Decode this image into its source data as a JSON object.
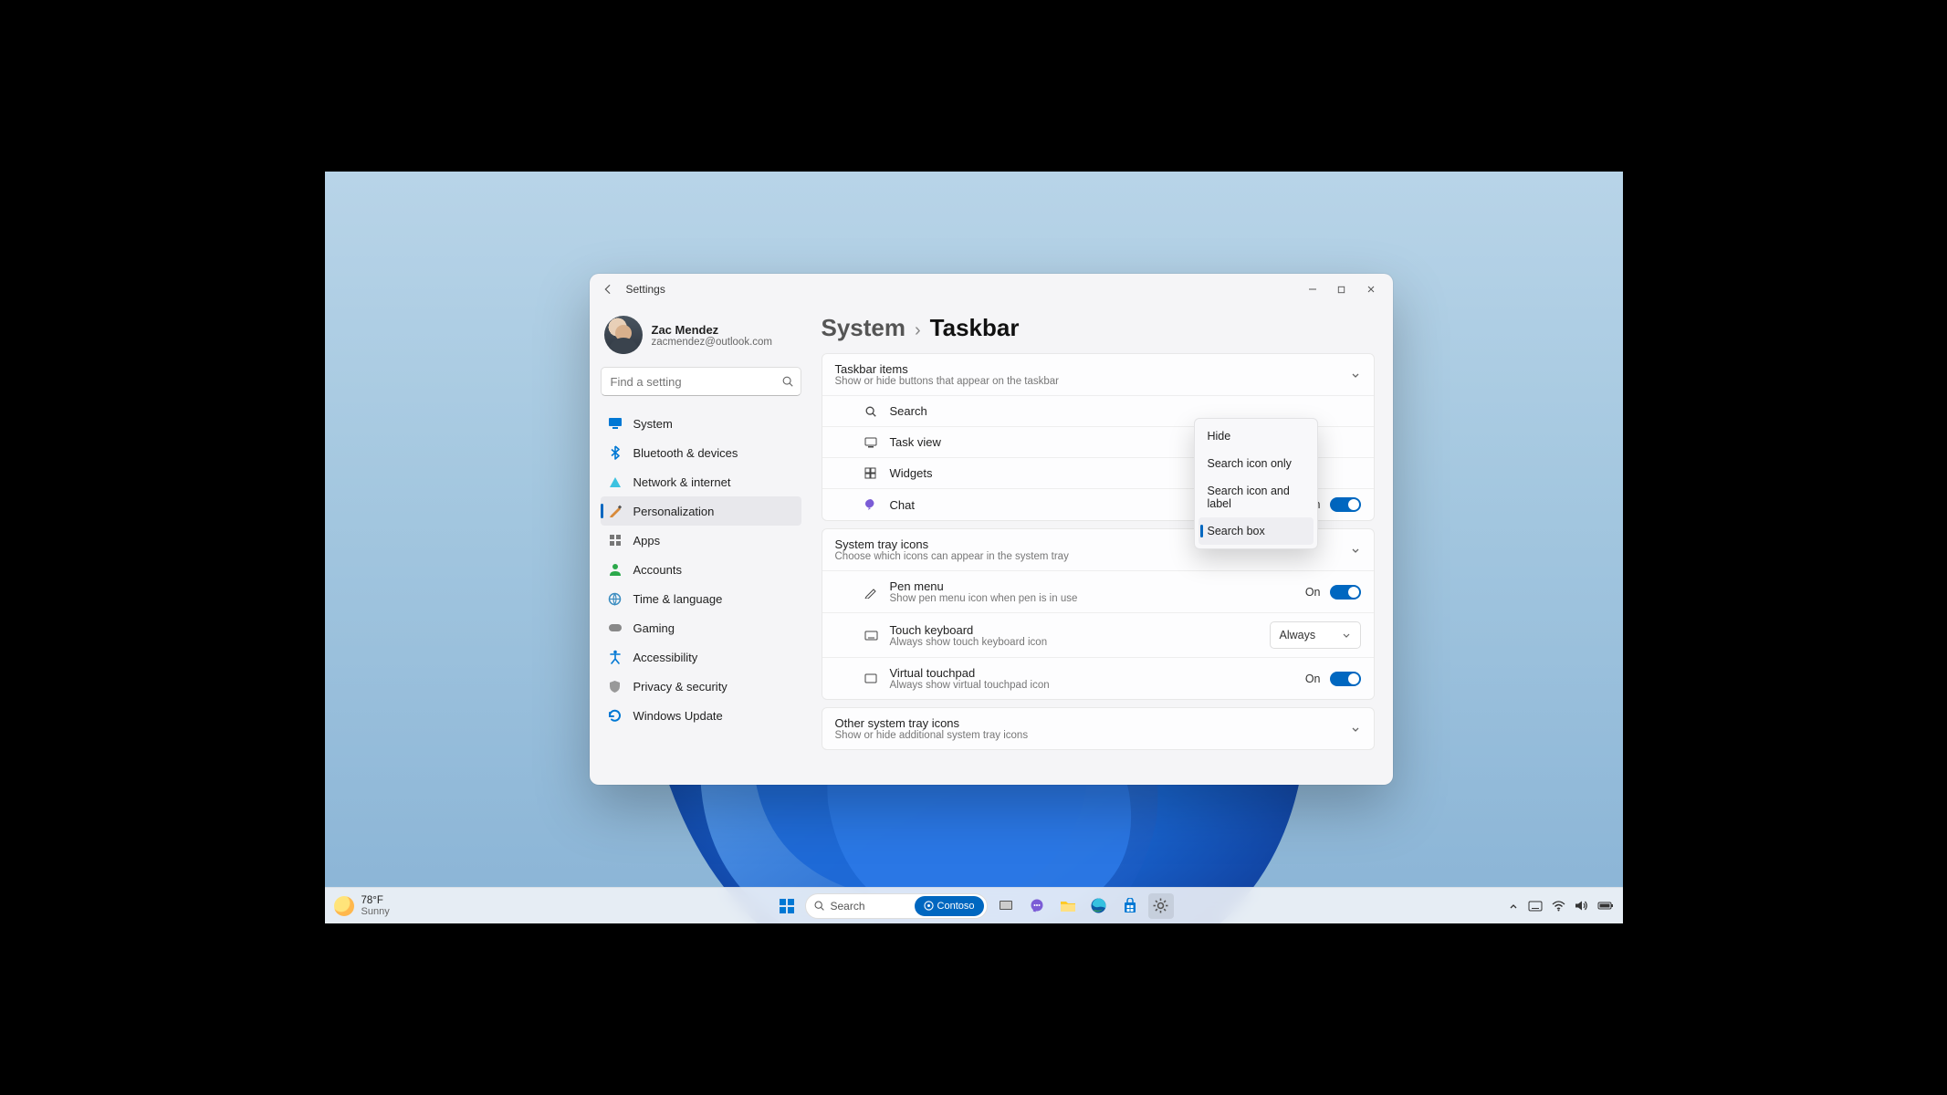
{
  "window": {
    "title": "Settings"
  },
  "profile": {
    "name": "Zac Mendez",
    "email": "zacmendez@outlook.com"
  },
  "search": {
    "placeholder": "Find a setting"
  },
  "sidebar": {
    "items": [
      {
        "label": "System"
      },
      {
        "label": "Bluetooth & devices"
      },
      {
        "label": "Network & internet"
      },
      {
        "label": "Personalization"
      },
      {
        "label": "Apps"
      },
      {
        "label": "Accounts"
      },
      {
        "label": "Time & language"
      },
      {
        "label": "Gaming"
      },
      {
        "label": "Accessibility"
      },
      {
        "label": "Privacy & security"
      },
      {
        "label": "Windows Update"
      }
    ],
    "active_index": 3
  },
  "breadcrumb": {
    "parent": "System",
    "separator": "›",
    "current": "Taskbar"
  },
  "sections": {
    "taskbar_items": {
      "title": "Taskbar items",
      "subtitle": "Show or hide buttons that appear on the taskbar",
      "rows": [
        {
          "label": "Search"
        },
        {
          "label": "Task view"
        },
        {
          "label": "Widgets"
        },
        {
          "label": "Chat",
          "toggle_state": "On"
        }
      ]
    },
    "system_tray": {
      "title": "System tray icons",
      "subtitle": "Choose which icons can appear in the system tray",
      "rows": [
        {
          "label": "Pen menu",
          "sub": "Show pen menu icon when pen is in use",
          "toggle_state": "On"
        },
        {
          "label": "Touch keyboard",
          "sub": "Always show touch keyboard icon",
          "select_value": "Always"
        },
        {
          "label": "Virtual touchpad",
          "sub": "Always show virtual touchpad icon",
          "toggle_state": "On"
        }
      ]
    },
    "other_tray": {
      "title": "Other system tray icons",
      "subtitle": "Show or hide additional system tray icons"
    }
  },
  "dropdown": {
    "items": [
      {
        "label": "Hide"
      },
      {
        "label": "Search icon only"
      },
      {
        "label": "Search icon and label"
      },
      {
        "label": "Search box"
      }
    ],
    "selected_index": 3
  },
  "taskbar": {
    "weather": {
      "temp": "78°F",
      "cond": "Sunny"
    },
    "search_placeholder": "Search",
    "search_pill": "Contoso"
  }
}
